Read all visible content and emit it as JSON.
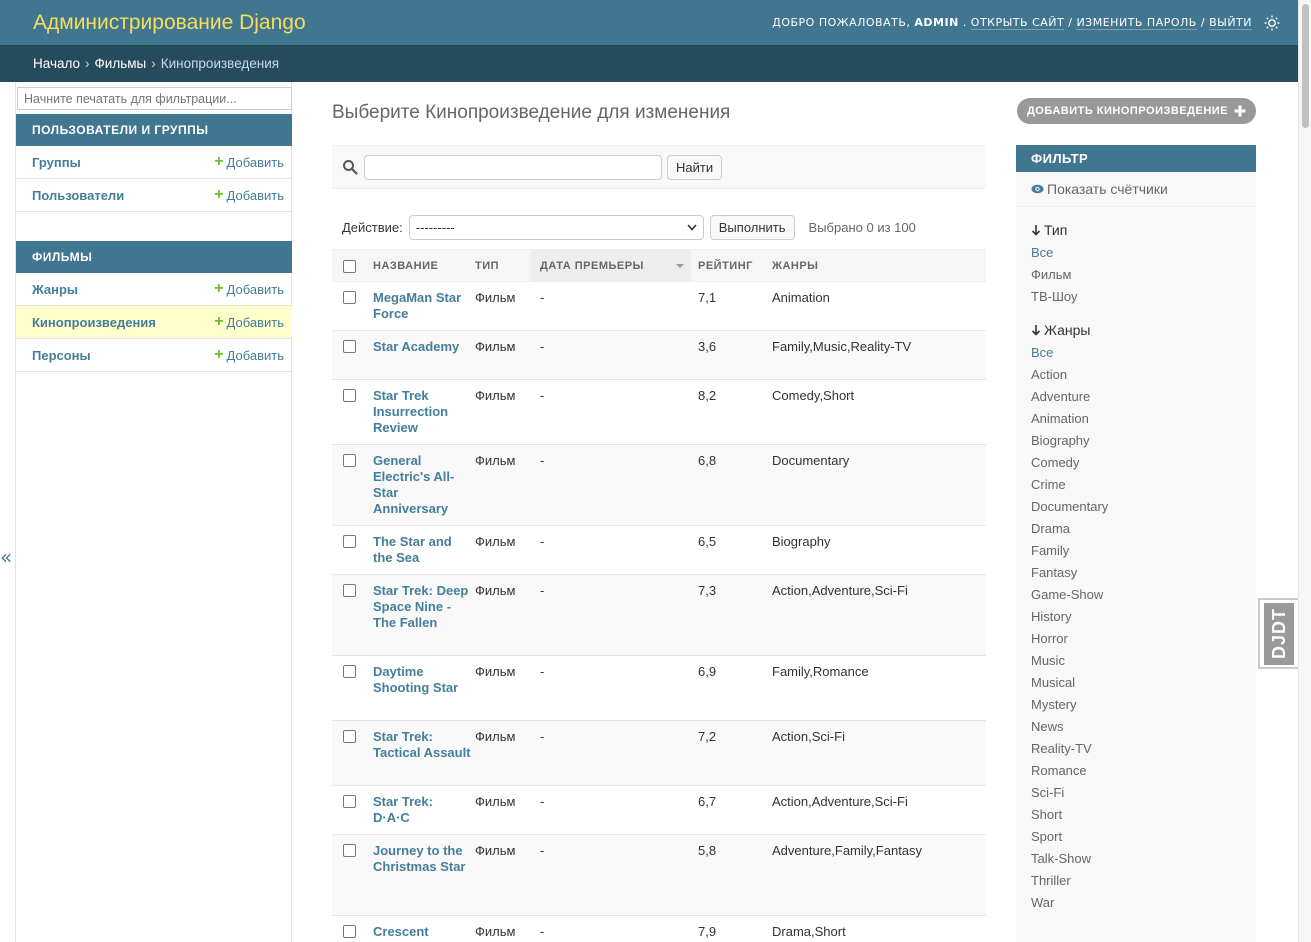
{
  "header": {
    "branding": "Администрирование Django",
    "welcome": "ДОБРО ПОЖАЛОВАТЬ,",
    "username": "ADMIN",
    "view_site": "ОТКРЫТЬ САЙТ",
    "change_password": "ИЗМЕНИТЬ ПАРОЛЬ",
    "logout": "ВЫЙТИ",
    "separator": "/"
  },
  "breadcrumbs": {
    "home": "Начало",
    "app": "Фильмы",
    "current": "Кинопроизведения",
    "sep": "›"
  },
  "sidebar": {
    "filter_placeholder": "Начните печатать для фильтрации...",
    "add_label": "Добавить",
    "modules": [
      {
        "caption": "ПОЛЬЗОВАТЕЛИ И ГРУППЫ",
        "models": [
          {
            "name": "Группы"
          },
          {
            "name": "Пользователи"
          }
        ]
      },
      {
        "caption": "ФИЛЬМЫ",
        "models": [
          {
            "name": "Жанры"
          },
          {
            "name": "Кинопроизведения"
          },
          {
            "name": "Персоны"
          }
        ]
      }
    ],
    "toggle": "«"
  },
  "content": {
    "title": "Выберите Кинопроизведение для изменения",
    "add_button": "ДОБАВИТЬ КИНОПРОИЗВЕДЕНИЕ",
    "search_button": "Найти",
    "action_label": "Действие:",
    "action_select_value": "---------",
    "action_go": "Выполнить",
    "action_counter": "Выбрано 0 из 100"
  },
  "table": {
    "headers": [
      "НАЗВАНИЕ",
      "ТИП",
      "ДАТА ПРЕМЬЕРЫ",
      "РЕЙТИНГ",
      "ЖАНРЫ"
    ],
    "rows": [
      {
        "title": "MegaMan Star Force",
        "type": "Фильм",
        "premiere": "-",
        "rating": "7,1",
        "genres": "Animation"
      },
      {
        "title": "Star Academy",
        "type": "Фильм",
        "premiere": "-",
        "rating": "3,6",
        "genres": "Family,Music,Reality-TV"
      },
      {
        "title": "Star Trek Insurrection Review",
        "type": "Фильм",
        "premiere": "-",
        "rating": "8,2",
        "genres": "Comedy,Short"
      },
      {
        "title": "General Electric's All-Star Anniversary",
        "type": "Фильм",
        "premiere": "-",
        "rating": "6,8",
        "genres": "Documentary"
      },
      {
        "title": "The Star and the Sea",
        "type": "Фильм",
        "premiere": "-",
        "rating": "6,5",
        "genres": "Biography"
      },
      {
        "title": "Star Trek: Deep Space Nine - The Fallen",
        "type": "Фильм",
        "premiere": "-",
        "rating": "7,3",
        "genres": "Action,Adventure,Sci-Fi"
      },
      {
        "title": "Daytime Shooting Star",
        "type": "Фильм",
        "premiere": "-",
        "rating": "6,9",
        "genres": "Family,Romance"
      },
      {
        "title": "Star Trek: Tactical Assault",
        "type": "Фильм",
        "premiere": "-",
        "rating": "7,2",
        "genres": "Action,Sci-Fi"
      },
      {
        "title": "Star Trek: D·A·C",
        "type": "Фильм",
        "premiere": "-",
        "rating": "6,7",
        "genres": "Action,Adventure,Sci-Fi"
      },
      {
        "title": "Journey to the Christmas Star",
        "type": "Фильм",
        "premiere": "-",
        "rating": "5,8",
        "genres": "Adventure,Family,Fantasy"
      },
      {
        "title": "Crescent",
        "type": "Фильм",
        "premiere": "-",
        "rating": "7,9",
        "genres": "Drama,Short"
      }
    ]
  },
  "filter": {
    "title": "ФИЛЬТР",
    "show_counts": "Показать счётчики",
    "type_heading": "Тип",
    "type_options": [
      "Все",
      "Фильм",
      "ТВ-Шоу"
    ],
    "genre_heading": "Жанры",
    "genre_options": [
      "Все",
      "Action",
      "Adventure",
      "Animation",
      "Biography",
      "Comedy",
      "Crime",
      "Documentary",
      "Drama",
      "Family",
      "Fantasy",
      "Game-Show",
      "History",
      "Horror",
      "Music",
      "Musical",
      "Mystery",
      "News",
      "Reality-TV",
      "Romance",
      "Sci-Fi",
      "Short",
      "Sport",
      "Talk-Show",
      "Thriller",
      "War"
    ]
  },
  "djdt": "DJDT"
}
